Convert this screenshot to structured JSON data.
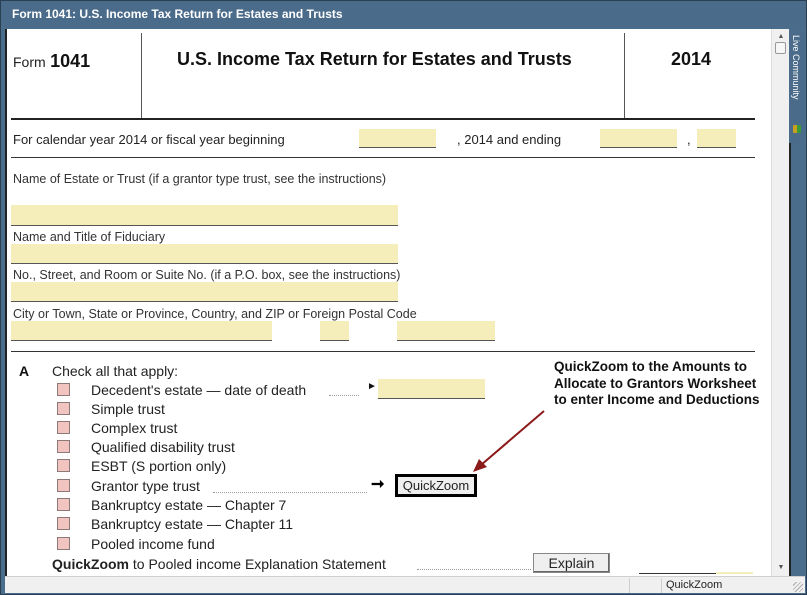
{
  "window": {
    "title": "Form 1041: U.S. Income Tax Return for Estates and Trusts"
  },
  "header": {
    "form_prefix": "Form",
    "form_number": "1041",
    "form_title": "U.S. Income Tax Return for Estates and Trusts",
    "year": "2014"
  },
  "period": {
    "label": "For calendar year 2014 or fiscal year beginning",
    "mid_label": ", 2014 and ending",
    "comma": ",",
    "begin_value": "",
    "end_value": "",
    "end_year_value": ""
  },
  "name_section": {
    "estate_label": "Name of Estate or Trust (if a grantor type trust, see the instructions)",
    "estate_value": "",
    "fiduciary_label": "Name and Title of Fiduciary",
    "fiduciary_value": "",
    "street_label": "No., Street, and Room or Suite No. (if a P.O. box, see the instructions)",
    "street_value": "",
    "city_label": "City or Town, State or Province, Country, and ZIP or Foreign Postal Code",
    "city_value": "",
    "state_value": "",
    "zip_value": ""
  },
  "section_a": {
    "letter": "A",
    "heading": "Check all that apply:",
    "items": [
      {
        "label": "Decedent's estate — date of death",
        "checked": false
      },
      {
        "label": "Simple trust",
        "checked": false
      },
      {
        "label": "Complex trust",
        "checked": false
      },
      {
        "label": "Qualified disability trust",
        "checked": false
      },
      {
        "label": "ESBT (S portion only)",
        "checked": false
      },
      {
        "label": "Grantor type trust",
        "checked": false
      },
      {
        "label": "Bankruptcy estate — Chapter 7",
        "checked": false
      },
      {
        "label": "Bankruptcy estate — Chapter 11",
        "checked": false
      },
      {
        "label": "Pooled income fund",
        "checked": false
      }
    ],
    "date_of_death_value": "",
    "quickzoom_button": "QuickZoom",
    "pooled_prefix": "QuickZoom",
    "pooled_rest": " to Pooled income Explanation Statement",
    "explain_button": "Explain"
  },
  "annotation": {
    "text": "QuickZoom to the Amounts to Allocate to Grantors Worksheet to enter Income and Deductions",
    "arrow_color": "#8b1a1a"
  },
  "sidebar": {
    "live_community": "Live Community"
  },
  "statusbar": {
    "mode": "QuickZoom"
  },
  "colors": {
    "titlebar": "#4a6b8a",
    "field_fill": "#f5eebb",
    "checkbox_fill": "#f2c4c0"
  }
}
